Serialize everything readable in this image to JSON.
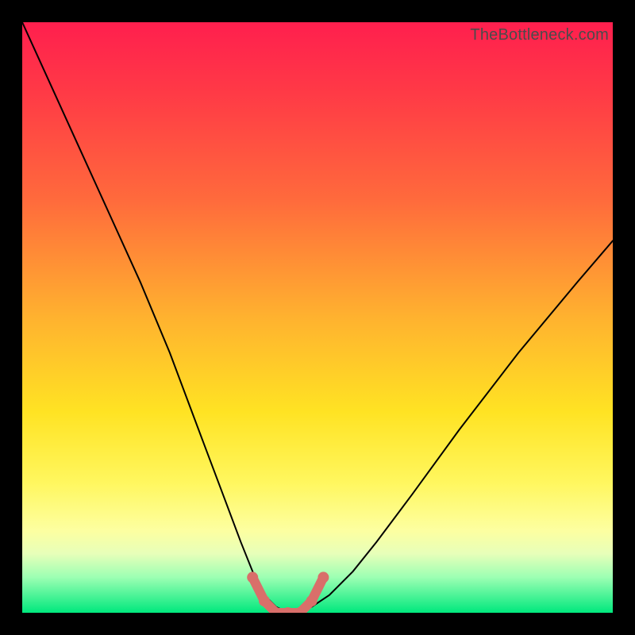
{
  "watermark": "TheBottleneck.com",
  "chart_data": {
    "type": "line",
    "title": "",
    "xlabel": "",
    "ylabel": "",
    "xlim": [
      0,
      100
    ],
    "ylim": [
      0,
      100
    ],
    "series": [
      {
        "name": "bottleneck-curve",
        "x": [
          0,
          5,
          10,
          15,
          20,
          25,
          28,
          31,
          34,
          37,
          39,
          41,
          43,
          45,
          47,
          49,
          52,
          56,
          60,
          66,
          74,
          84,
          94,
          100
        ],
        "y": [
          100,
          89,
          78,
          67,
          56,
          44,
          36,
          28,
          20,
          12,
          7,
          3,
          1,
          0,
          0,
          1,
          3,
          7,
          12,
          20,
          31,
          44,
          56,
          63
        ],
        "stroke": "#000000",
        "stroke_width": 2
      },
      {
        "name": "valley-marker",
        "x": [
          39,
          41,
          43,
          45,
          47,
          49,
          51
        ],
        "y": [
          6,
          2,
          0,
          0,
          0,
          2,
          6
        ],
        "stroke": "#d96f6a",
        "stroke_width": 12,
        "dots": true
      }
    ],
    "gradient_stops": [
      {
        "pos": 0.0,
        "color": "#ff1f4e"
      },
      {
        "pos": 0.3,
        "color": "#ff6a3c"
      },
      {
        "pos": 0.5,
        "color": "#ffb22f"
      },
      {
        "pos": 0.78,
        "color": "#fff75f"
      },
      {
        "pos": 1.0,
        "color": "#00e87d"
      }
    ]
  }
}
